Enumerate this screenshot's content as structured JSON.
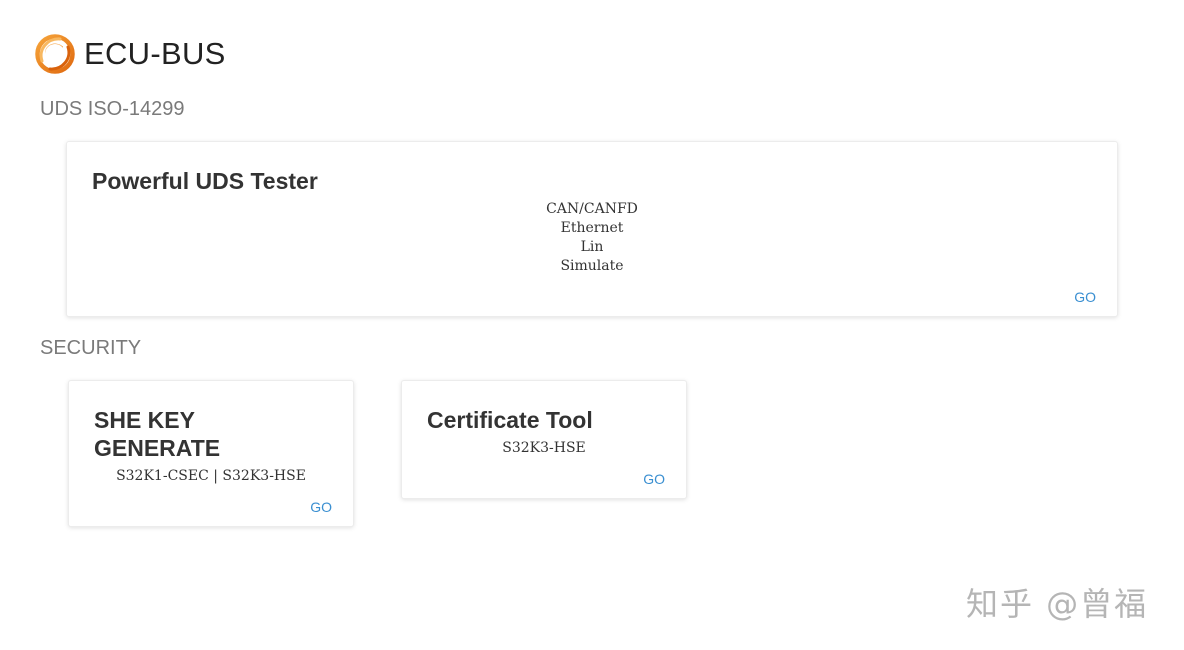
{
  "header": {
    "logo_icon": "orange-swirl-logo-icon",
    "title": "ECU-BUS"
  },
  "sections": [
    {
      "title": "UDS ISO-14299",
      "cards": [
        {
          "title": "Powerful UDS Tester",
          "lines": [
            "CAN/CANFD",
            "Ethernet",
            "Lin",
            "Simulate"
          ],
          "go_label": "GO"
        }
      ]
    },
    {
      "title": "SECURITY",
      "cards": [
        {
          "title_lines": [
            "SHE KEY",
            "GENERATE"
          ],
          "lines": [
            "S32K1-CSEC | S32K3-HSE"
          ],
          "go_label": "GO"
        },
        {
          "title": "Certificate Tool",
          "lines": [
            "S32K3-HSE"
          ],
          "go_label": "GO"
        }
      ]
    }
  ],
  "watermark": "知乎 @曾福",
  "colors": {
    "accent_link": "#3a8fd1",
    "logo_orange": "#f08a1c",
    "section_gray": "#7a7a7a"
  }
}
